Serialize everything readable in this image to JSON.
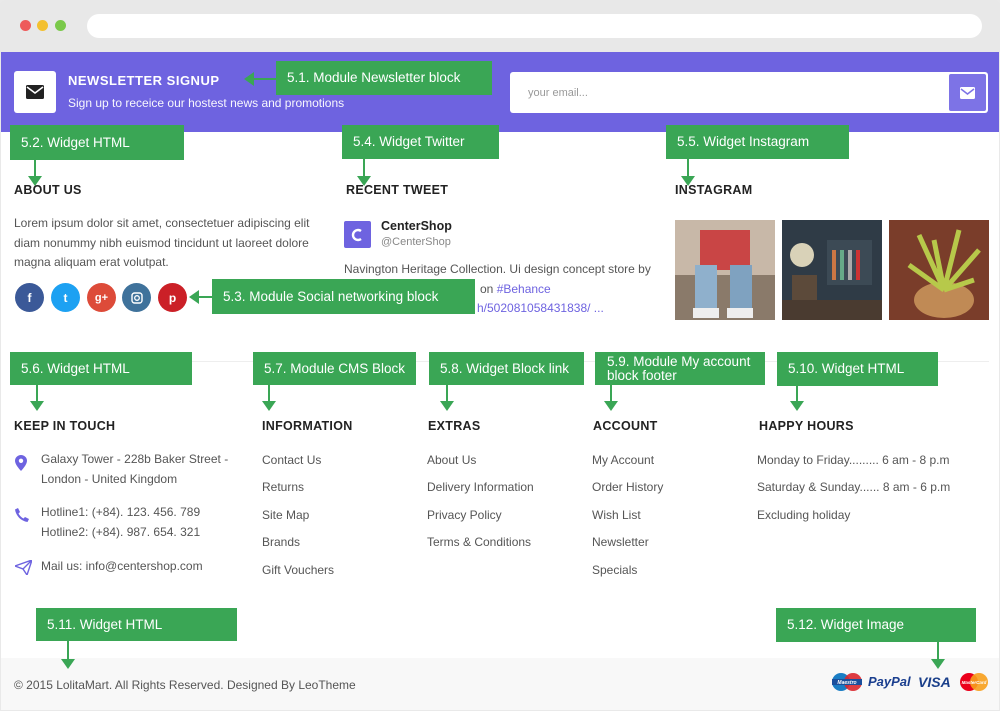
{
  "newsletter": {
    "title": "NEWSLETTER SIGNUP",
    "subtitle": "Sign up to receice our hostest news and promotions",
    "placeholder": "your email...",
    "accent": "#6e63e0"
  },
  "annotations": {
    "a51": "5.1. Module Newsletter block",
    "a52": "5.2. Widget HTML",
    "a53": "5.3. Module Social networking block",
    "a54": "5.4. Widget Twitter",
    "a55": "5.5. Widget Instagram",
    "a56": "5.6. Widget HTML",
    "a57": "5.7. Module CMS Block",
    "a58": "5.8. Widget Block link",
    "a59a": "5.9. Module My account",
    "a59b": "block footer",
    "a510": "5.10. Widget HTML",
    "a511": "5.11. Widget HTML",
    "a512": "5.12. Widget Image",
    "color": "#3aa655"
  },
  "about": {
    "title": "ABOUT US",
    "lines": [
      "Lorem ipsum dolor sit amet, consectetuer adipiscing elit",
      "diam nonummy nibh euismod tincidunt ut laoreet dolore",
      "magna aliquam erat volutpat."
    ]
  },
  "social": [
    {
      "icon": "facebook-icon",
      "glyph": "f",
      "color": "#3b5998"
    },
    {
      "icon": "twitter-icon",
      "glyph": "t",
      "color": "#1da1f2"
    },
    {
      "icon": "google-plus-icon",
      "glyph": "g+",
      "color": "#dd4b39"
    },
    {
      "icon": "instagram-icon",
      "glyph": "◘",
      "color": "#3f729b"
    },
    {
      "icon": "pinterest-icon",
      "glyph": "p",
      "color": "#cb2027"
    }
  ],
  "tweet": {
    "title": "RECENT TWEET",
    "name": "CenterShop",
    "handle": "@CenterShop",
    "line1": "Navington Heritage Collection. Ui design concept store by",
    "line2_prefix": "on ",
    "line2_link": "#Behance",
    "line3_link": "h/502081058431838/ ..."
  },
  "instagram": {
    "title": "INSTAGRAM"
  },
  "keep": {
    "title": "KEEP IN TOUCH",
    "address1": "Galaxy Tower - 228b Baker Street -",
    "address2": "London - United Kingdom",
    "hotline1": "Hotline1: (+84). 123. 456. 789",
    "hotline2": "Hotline2: (+84). 987. 654. 321",
    "mail": "Mail us: info@centershop.com"
  },
  "information": {
    "title": "INFORMATION",
    "items": [
      "Contact Us",
      "Returns",
      "Site Map",
      "Brands",
      "Gift Vouchers"
    ]
  },
  "extras": {
    "title": "EXTRAS",
    "items": [
      "About Us",
      "Delivery Information",
      "Privacy Policy",
      "Terms & Conditions"
    ]
  },
  "account": {
    "title": "ACCOUNT",
    "items": [
      "My Account",
      "Order History",
      "Wish List",
      "Newsletter",
      "Specials"
    ]
  },
  "hours": {
    "title": "HAPPY HOURS",
    "items": [
      "Monday to Friday......... 6 am - 8 p.m",
      "Saturday & Sunday...... 8 am - 6 p.m",
      "Excluding holiday"
    ]
  },
  "footer": {
    "copyright": "© 2015 LolitaMart. All Rights Reserved. Designed By LeoTheme",
    "maestro": "Maestro",
    "paypal": "PayPal",
    "visa": "VISA",
    "mastercard": "MasterCard"
  }
}
